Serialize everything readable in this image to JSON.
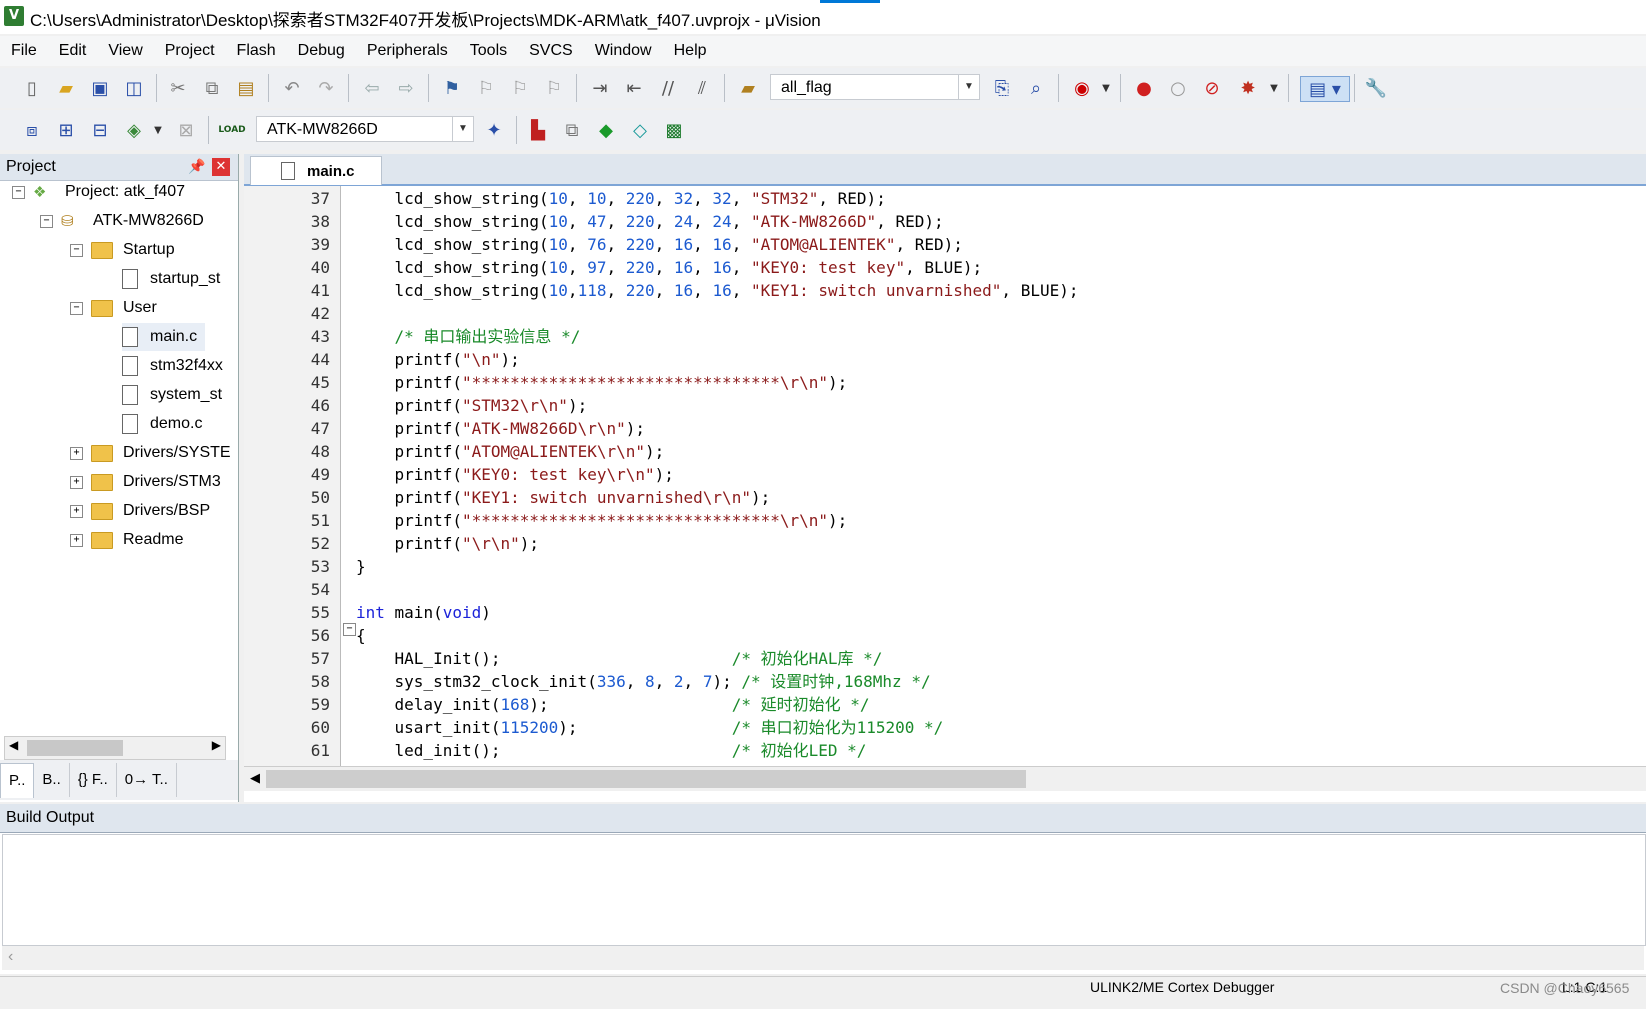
{
  "window": {
    "title": "C:\\Users\\Administrator\\Desktop\\探索者STM32F407开发板\\Projects\\MDK-ARM\\atk_f407.uvprojx - μVision",
    "app_icon_letter": "V"
  },
  "menu": [
    "File",
    "Edit",
    "View",
    "Project",
    "Flash",
    "Debug",
    "Peripherals",
    "Tools",
    "SVCS",
    "Window",
    "Help"
  ],
  "toolbar1": {
    "find_combo_value": "all_flag"
  },
  "toolbar2": {
    "target_combo_value": "ATK-MW8266D",
    "load_label": "LOAD"
  },
  "project_panel": {
    "title": "Project",
    "tree": [
      {
        "label": "Project: atk_f407",
        "type": "project",
        "level": 0,
        "toggle": "−"
      },
      {
        "label": "ATK-MW8266D",
        "type": "target",
        "level": 1,
        "toggle": "−"
      },
      {
        "label": "Startup",
        "type": "folder",
        "level": 2,
        "toggle": "−"
      },
      {
        "label": "startup_st",
        "type": "file",
        "level": 3
      },
      {
        "label": "User",
        "type": "folder",
        "level": 2,
        "toggle": "−"
      },
      {
        "label": "main.c",
        "type": "file",
        "level": 3
      },
      {
        "label": "stm32f4xx",
        "type": "file",
        "level": 3
      },
      {
        "label": "system_st",
        "type": "file",
        "level": 3
      },
      {
        "label": "demo.c",
        "type": "file",
        "level": 3
      },
      {
        "label": "Drivers/SYSTE",
        "type": "folder",
        "level": 2,
        "toggle": "+"
      },
      {
        "label": "Drivers/STM3",
        "type": "folder",
        "level": 2,
        "toggle": "+"
      },
      {
        "label": "Drivers/BSP",
        "type": "folder",
        "level": 2,
        "toggle": "+"
      },
      {
        "label": "Readme",
        "type": "folder",
        "level": 2,
        "toggle": "+"
      }
    ],
    "tabs": [
      "P..",
      "B..",
      "{} F..",
      "0→ T.."
    ]
  },
  "editor": {
    "tab_label": "main.c",
    "lines": [
      {
        "n": "37",
        "tokens": [
          [
            "fn",
            "    lcd_show_string("
          ],
          [
            "num",
            "10"
          ],
          [
            "fn",
            ", "
          ],
          [
            "num",
            "10"
          ],
          [
            "fn",
            ", "
          ],
          [
            "num",
            "220"
          ],
          [
            "fn",
            ", "
          ],
          [
            "num",
            "32"
          ],
          [
            "fn",
            ", "
          ],
          [
            "num",
            "32"
          ],
          [
            "fn",
            ", "
          ],
          [
            "str",
            "\"STM32\""
          ],
          [
            "fn",
            ", RED);"
          ]
        ]
      },
      {
        "n": "38",
        "tokens": [
          [
            "fn",
            "    lcd_show_string("
          ],
          [
            "num",
            "10"
          ],
          [
            "fn",
            ", "
          ],
          [
            "num",
            "47"
          ],
          [
            "fn",
            ", "
          ],
          [
            "num",
            "220"
          ],
          [
            "fn",
            ", "
          ],
          [
            "num",
            "24"
          ],
          [
            "fn",
            ", "
          ],
          [
            "num",
            "24"
          ],
          [
            "fn",
            ", "
          ],
          [
            "str",
            "\"ATK-MW8266D\""
          ],
          [
            "fn",
            ", RED);"
          ]
        ]
      },
      {
        "n": "39",
        "tokens": [
          [
            "fn",
            "    lcd_show_string("
          ],
          [
            "num",
            "10"
          ],
          [
            "fn",
            ", "
          ],
          [
            "num",
            "76"
          ],
          [
            "fn",
            ", "
          ],
          [
            "num",
            "220"
          ],
          [
            "fn",
            ", "
          ],
          [
            "num",
            "16"
          ],
          [
            "fn",
            ", "
          ],
          [
            "num",
            "16"
          ],
          [
            "fn",
            ", "
          ],
          [
            "str",
            "\"ATOM@ALIENTEK\""
          ],
          [
            "fn",
            ", RED);"
          ]
        ]
      },
      {
        "n": "40",
        "tokens": [
          [
            "fn",
            "    lcd_show_string("
          ],
          [
            "num",
            "10"
          ],
          [
            "fn",
            ", "
          ],
          [
            "num",
            "97"
          ],
          [
            "fn",
            ", "
          ],
          [
            "num",
            "220"
          ],
          [
            "fn",
            ", "
          ],
          [
            "num",
            "16"
          ],
          [
            "fn",
            ", "
          ],
          [
            "num",
            "16"
          ],
          [
            "fn",
            ", "
          ],
          [
            "str",
            "\"KEY0: test key\""
          ],
          [
            "fn",
            ", BLUE);"
          ]
        ]
      },
      {
        "n": "41",
        "tokens": [
          [
            "fn",
            "    lcd_show_string("
          ],
          [
            "num",
            "10"
          ],
          [
            "fn",
            ","
          ],
          [
            "num",
            "118"
          ],
          [
            "fn",
            ", "
          ],
          [
            "num",
            "220"
          ],
          [
            "fn",
            ", "
          ],
          [
            "num",
            "16"
          ],
          [
            "fn",
            ", "
          ],
          [
            "num",
            "16"
          ],
          [
            "fn",
            ", "
          ],
          [
            "str",
            "\"KEY1: switch unvarnished\""
          ],
          [
            "fn",
            ", BLUE);"
          ]
        ]
      },
      {
        "n": "42",
        "tokens": []
      },
      {
        "n": "43",
        "tokens": [
          [
            "cmt",
            "    /* 串口输出实验信息 */"
          ]
        ]
      },
      {
        "n": "44",
        "tokens": [
          [
            "fn",
            "    printf("
          ],
          [
            "str",
            "\"\\n\""
          ],
          [
            "fn",
            ");"
          ]
        ]
      },
      {
        "n": "45",
        "tokens": [
          [
            "fn",
            "    printf("
          ],
          [
            "str",
            "\"********************************\\r\\n\""
          ],
          [
            "fn",
            ");"
          ]
        ]
      },
      {
        "n": "46",
        "tokens": [
          [
            "fn",
            "    printf("
          ],
          [
            "str",
            "\"STM32\\r\\n\""
          ],
          [
            "fn",
            ");"
          ]
        ]
      },
      {
        "n": "47",
        "tokens": [
          [
            "fn",
            "    printf("
          ],
          [
            "str",
            "\"ATK-MW8266D\\r\\n\""
          ],
          [
            "fn",
            ");"
          ]
        ]
      },
      {
        "n": "48",
        "tokens": [
          [
            "fn",
            "    printf("
          ],
          [
            "str",
            "\"ATOM@ALIENTEK\\r\\n\""
          ],
          [
            "fn",
            ");"
          ]
        ]
      },
      {
        "n": "49",
        "tokens": [
          [
            "fn",
            "    printf("
          ],
          [
            "str",
            "\"KEY0: test key\\r\\n\""
          ],
          [
            "fn",
            ");"
          ]
        ]
      },
      {
        "n": "50",
        "tokens": [
          [
            "fn",
            "    printf("
          ],
          [
            "str",
            "\"KEY1: switch unvarnished\\r\\n\""
          ],
          [
            "fn",
            ");"
          ]
        ]
      },
      {
        "n": "51",
        "tokens": [
          [
            "fn",
            "    printf("
          ],
          [
            "str",
            "\"********************************\\r\\n\""
          ],
          [
            "fn",
            ");"
          ]
        ]
      },
      {
        "n": "52",
        "tokens": [
          [
            "fn",
            "    printf("
          ],
          [
            "str",
            "\"\\r\\n\""
          ],
          [
            "fn",
            ");"
          ]
        ]
      },
      {
        "n": "53",
        "tokens": [
          [
            "fn",
            "}"
          ]
        ]
      },
      {
        "n": "54",
        "tokens": []
      },
      {
        "n": "55",
        "tokens": [
          [
            "kw",
            "int"
          ],
          [
            "fn",
            " main("
          ],
          [
            "kw",
            "void"
          ],
          [
            "fn",
            ")"
          ]
        ]
      },
      {
        "n": "56",
        "tokens": [
          [
            "fn",
            "{"
          ]
        ]
      },
      {
        "n": "57",
        "tokens": [
          [
            "fn",
            "    HAL_Init();                        "
          ],
          [
            "cmt",
            "/* 初始化HAL库 */"
          ]
        ]
      },
      {
        "n": "58",
        "tokens": [
          [
            "fn",
            "    sys_stm32_clock_init("
          ],
          [
            "num",
            "336"
          ],
          [
            "fn",
            ", "
          ],
          [
            "num",
            "8"
          ],
          [
            "fn",
            ", "
          ],
          [
            "num",
            "2"
          ],
          [
            "fn",
            ", "
          ],
          [
            "num",
            "7"
          ],
          [
            "fn",
            "); "
          ],
          [
            "cmt",
            "/* 设置时钟,168Mhz */"
          ]
        ]
      },
      {
        "n": "59",
        "tokens": [
          [
            "fn",
            "    delay_init("
          ],
          [
            "num",
            "168"
          ],
          [
            "fn",
            ");                   "
          ],
          [
            "cmt",
            "/* 延时初始化 */"
          ]
        ]
      },
      {
        "n": "60",
        "tokens": [
          [
            "fn",
            "    usart_init("
          ],
          [
            "num",
            "115200"
          ],
          [
            "fn",
            ");                "
          ],
          [
            "cmt",
            "/* 串口初始化为115200 */"
          ]
        ]
      },
      {
        "n": "61",
        "tokens": [
          [
            "fn",
            "    led_init();                        "
          ],
          [
            "cmt",
            "/* 初始化LED */"
          ]
        ]
      }
    ]
  },
  "build_output": {
    "title": "Build Output"
  },
  "statusbar": {
    "debugger": "ULINK2/ME Cortex Debugger",
    "position": "L:1 C:1"
  },
  "watermark": "CSDN @Chaoy6565"
}
